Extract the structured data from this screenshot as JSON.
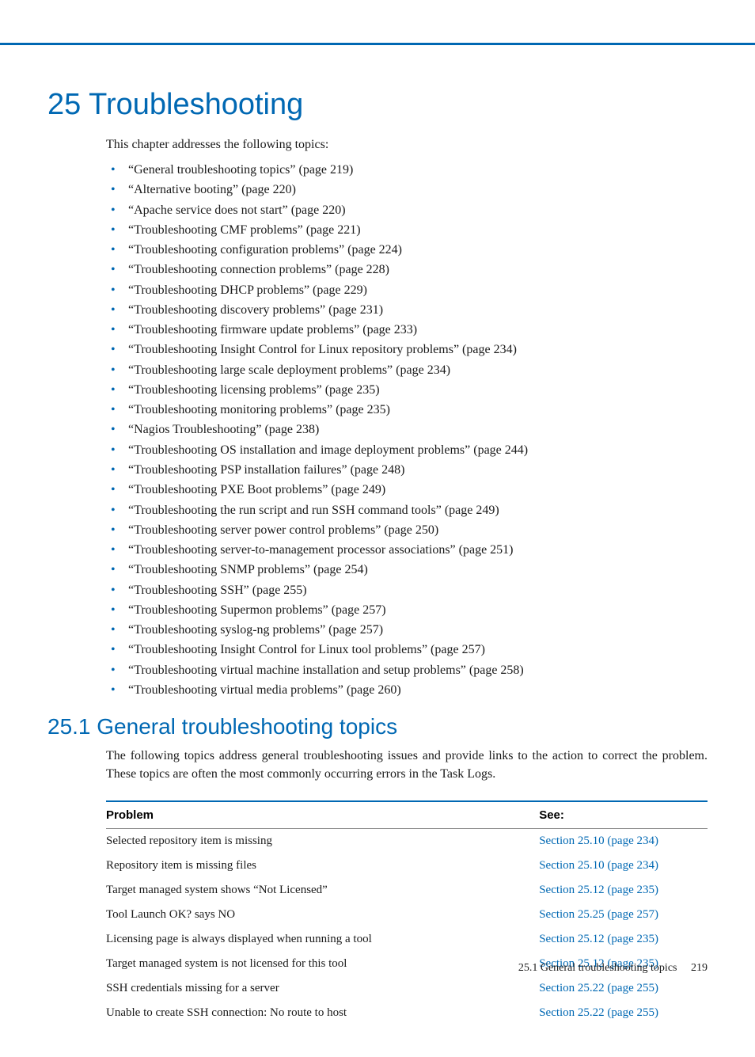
{
  "chapter": {
    "number": "25",
    "title": "Troubleshooting"
  },
  "intro": "This chapter addresses the following topics:",
  "toc": [
    "“General troubleshooting topics” (page 219)",
    "“Alternative booting” (page 220)",
    "“Apache service does not start” (page 220)",
    "“Troubleshooting CMF problems” (page 221)",
    "“Troubleshooting configuration problems” (page 224)",
    "“Troubleshooting connection problems” (page 228)",
    "“Troubleshooting DHCP problems” (page 229)",
    "“Troubleshooting discovery problems” (page 231)",
    "“Troubleshooting firmware update problems” (page 233)",
    "“Troubleshooting Insight Control for Linux repository problems” (page 234)",
    "“Troubleshooting large scale deployment problems” (page 234)",
    "“Troubleshooting licensing problems” (page 235)",
    "“Troubleshooting monitoring problems” (page 235)",
    "“Nagios Troubleshooting” (page 238)",
    "“Troubleshooting OS installation and image deployment problems” (page 244)",
    "“Troubleshooting PSP installation failures” (page 248)",
    "“Troubleshooting PXE Boot problems” (page 249)",
    "“Troubleshooting the run script and run SSH command tools” (page 249)",
    "“Troubleshooting server power control problems” (page 250)",
    "“Troubleshooting server-to-management processor associations” (page 251)",
    "“Troubleshooting SNMP problems” (page 254)",
    "“Troubleshooting SSH” (page 255)",
    "“Troubleshooting Supermon problems” (page 257)",
    "“Troubleshooting syslog-ng problems” (page 257)",
    "“Troubleshooting Insight Control for Linux tool problems” (page 257)",
    "“Troubleshooting virtual machine installation and setup problems” (page 258)",
    "“Troubleshooting virtual media problems” (page 260)"
  ],
  "section": {
    "number": "25.1",
    "title": "General troubleshooting topics",
    "text": "The following topics address general troubleshooting issues and provide links to the action to correct the problem. These topics are often the most commonly occurring errors in the Task Logs."
  },
  "table": {
    "headers": {
      "problem": "Problem",
      "see": "See:"
    },
    "rows": [
      {
        "problem": "Selected repository item is missing",
        "see": "Section 25.10 (page 234)"
      },
      {
        "problem": "Repository item is missing files",
        "see": "Section 25.10 (page 234)"
      },
      {
        "problem": "Target managed system shows “Not Licensed”",
        "see": "Section 25.12 (page 235)"
      },
      {
        "problem": "Tool Launch OK? says NO",
        "see": "Section 25.25 (page 257)"
      },
      {
        "problem": "Licensing page is always displayed when running a tool",
        "see": "Section 25.12 (page 235)"
      },
      {
        "problem": "Target managed system is not licensed for this tool",
        "see": "Section 25.12 (page 235)"
      },
      {
        "problem": "SSH credentials missing for a server",
        "see": "Section 25.22 (page 255)"
      },
      {
        "problem": "Unable to create SSH connection: No route to host",
        "see": "Section 25.22 (page 255)"
      }
    ]
  },
  "footer": {
    "label": "25.1 General troubleshooting topics",
    "page": "219"
  }
}
